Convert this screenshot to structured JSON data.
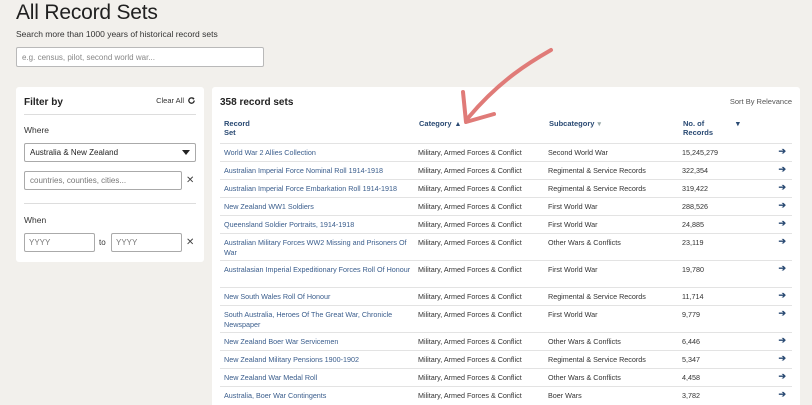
{
  "page": {
    "title": "All Record Sets",
    "subtitle": "Search more than 1000 years of historical record sets",
    "search_placeholder": "e.g. census, pilot, second world war..."
  },
  "filter": {
    "title": "Filter by",
    "clear_label": "Clear All",
    "where_label": "Where",
    "where_value": "Australia & New Zealand",
    "places_placeholder": "countries, counties, cities...",
    "when_label": "When",
    "from_placeholder": "YYYY",
    "to_label": "to",
    "to_placeholder": "YYYY"
  },
  "results": {
    "count": "358 record sets",
    "sort_label": "Sort By Relevance",
    "columns": {
      "title": "Record Set",
      "category": "Category",
      "subcategory": "Subcategory",
      "records": "No. of Records"
    },
    "rows": [
      {
        "title": "World War 2 Allies Collection",
        "category": "Military, Armed Forces & Conflict",
        "subcategory": "Second World War",
        "records": "15,245,279"
      },
      {
        "title": "Australian Imperial Force Nominal Roll 1914-1918",
        "category": "Military, Armed Forces & Conflict",
        "subcategory": "Regimental & Service Records",
        "records": "322,354"
      },
      {
        "title": "Australian Imperial Force Embarkation Roll 1914-1918",
        "category": "Military, Armed Forces & Conflict",
        "subcategory": "Regimental & Service Records",
        "records": "319,422"
      },
      {
        "title": "New Zealand WW1 Soldiers",
        "category": "Military, Armed Forces & Conflict",
        "subcategory": "First World War",
        "records": "288,526"
      },
      {
        "title": "Queensland Soldier Portraits, 1914-1918",
        "category": "Military, Armed Forces & Conflict",
        "subcategory": "First World War",
        "records": "24,885"
      },
      {
        "title": "Australian Military Forces WW2 Missing and Prisoners Of War",
        "category": "Military, Armed Forces & Conflict",
        "subcategory": "Other Wars & Conflicts",
        "records": "23,119"
      },
      {
        "title": "Australasian Imperial Expeditionary Forces Roll Of Honour",
        "category": "Military, Armed Forces & Conflict",
        "subcategory": "First World War",
        "records": "19,780"
      },
      {
        "title": "New South Wales Roll Of Honour",
        "category": "Military, Armed Forces & Conflict",
        "subcategory": "Regimental & Service Records",
        "records": "11,714"
      },
      {
        "title": "South Australia, Heroes Of The Great War, Chronicle Newspaper",
        "category": "Military, Armed Forces & Conflict",
        "subcategory": "First World War",
        "records": "9,779"
      },
      {
        "title": "New Zealand Boer War Servicemen",
        "category": "Military, Armed Forces & Conflict",
        "subcategory": "Other Wars & Conflicts",
        "records": "6,446"
      },
      {
        "title": "New Zealand Military Pensions 1900-1902",
        "category": "Military, Armed Forces & Conflict",
        "subcategory": "Regimental & Service Records",
        "records": "5,347"
      },
      {
        "title": "New Zealand War Medal Roll",
        "category": "Military, Armed Forces & Conflict",
        "subcategory": "Other Wars & Conflicts",
        "records": "4,458"
      },
      {
        "title": "Australia, Boer War Contingents",
        "category": "Military, Armed Forces & Conflict",
        "subcategory": "Boer Wars",
        "records": "3,782"
      }
    ]
  },
  "colors": {
    "background": "#f2f0ec",
    "link": "#3a5d8c",
    "header": "#2a4a73",
    "annotation": "#e07b78"
  }
}
